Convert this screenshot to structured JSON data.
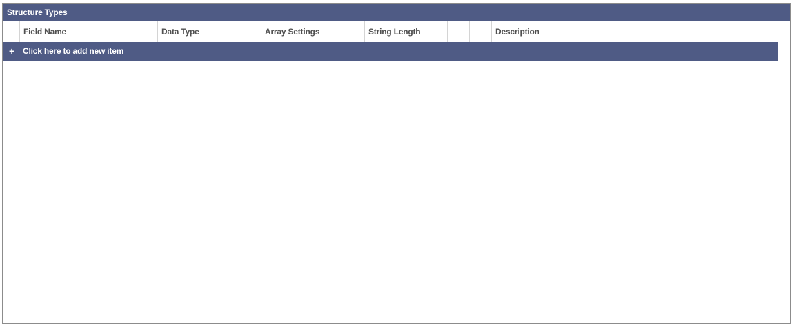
{
  "panel": {
    "title": "Structure Types"
  },
  "grid": {
    "columns": [
      {
        "key": "row_selector",
        "label": ""
      },
      {
        "key": "field_name",
        "label": "Field Name"
      },
      {
        "key": "data_type",
        "label": "Data Type"
      },
      {
        "key": "array_settings",
        "label": "Array Settings"
      },
      {
        "key": "string_length",
        "label": "String Length"
      },
      {
        "key": "extra_1",
        "label": ""
      },
      {
        "key": "extra_2",
        "label": ""
      },
      {
        "key": "description",
        "label": "Description"
      },
      {
        "key": "filler",
        "label": ""
      }
    ],
    "rows": []
  },
  "add_row": {
    "icon": "plus-icon",
    "icon_glyph": "+",
    "label": "Click here to add new item"
  },
  "colors": {
    "header_bg": "#4f5b85",
    "header_text": "#ffffff",
    "column_text": "#505050",
    "border": "#8c8c8c"
  }
}
